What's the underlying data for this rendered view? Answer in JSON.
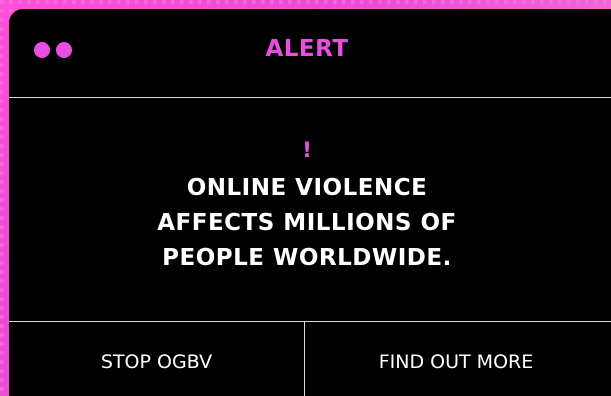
{
  "window": {
    "title": "ALERT",
    "exclamation": "!",
    "message_lines": [
      "ONLINE VIOLENCE",
      "AFFECTS MILLIONS OF",
      "PEOPLE WORLDWIDE."
    ]
  },
  "buttons": {
    "left_label": "STOP OGBV",
    "right_label": "FIND OUT MORE"
  },
  "colors": {
    "accent": "#e84fe0",
    "window_bg": "#000000",
    "text": "#ffffff",
    "divider": "#d9d9d9"
  }
}
